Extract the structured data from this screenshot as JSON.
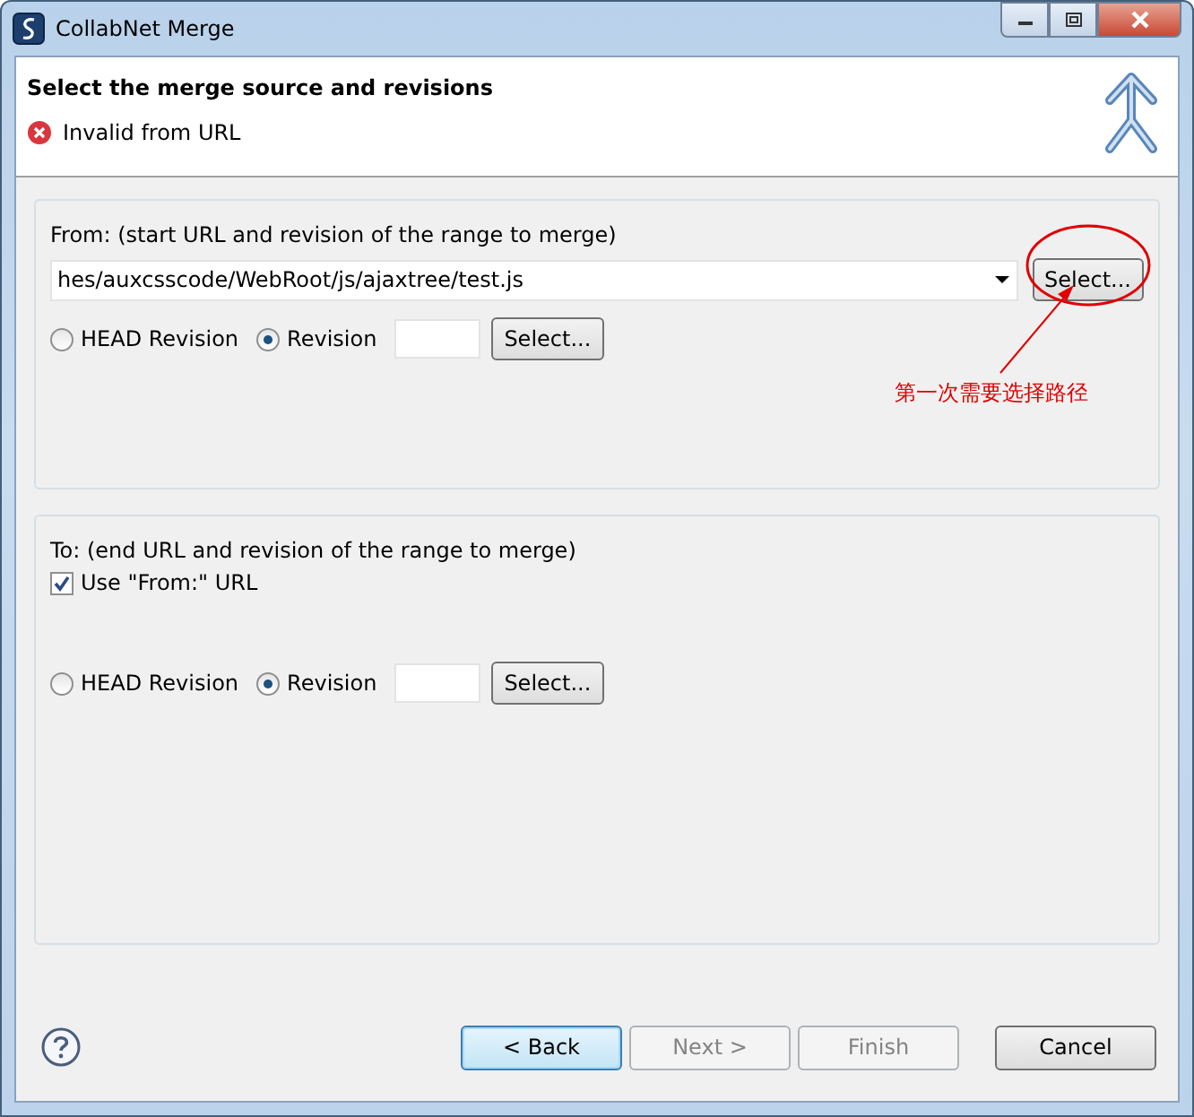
{
  "window": {
    "title": "CollabNet Merge"
  },
  "header": {
    "title": "Select the merge source and revisions",
    "message": "Invalid from URL"
  },
  "from_group": {
    "legend": "From: (start URL and revision of the range to merge)",
    "url": "hes/auxcsscode/WebRoot/js/ajaxtree/test.js",
    "url_button": "Select...",
    "radios": [
      {
        "label": "HEAD Revision",
        "selected": false
      },
      {
        "label": "Revision",
        "selected": true
      }
    ],
    "revision_button": "Select..."
  },
  "annotation": {
    "text": "第一次需要选择路径"
  },
  "to_group": {
    "legend": "To: (end URL and revision of the range to merge)",
    "use_from": {
      "label": "Use \"From:\" URL",
      "checked": true
    },
    "radios": [
      {
        "label": "HEAD Revision",
        "selected": false
      },
      {
        "label": "Revision",
        "selected": true
      }
    ],
    "revision_button": "Select..."
  },
  "buttons": [
    {
      "label": "< Back",
      "disabled": false,
      "default": true
    },
    {
      "label": "Next >",
      "disabled": true,
      "default": false
    },
    {
      "label": "Finish",
      "disabled": true,
      "default": false
    },
    {
      "label": "Cancel",
      "disabled": false,
      "default": false
    }
  ]
}
